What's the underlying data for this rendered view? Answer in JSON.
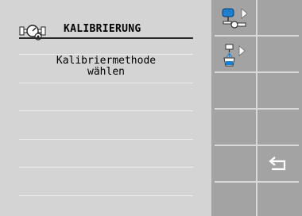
{
  "header": {
    "title": "KALIBRIERUNG",
    "icon": "calibration-gauge-icon"
  },
  "content": {
    "method_line1": "Kalibriermethode",
    "method_line2": "wählen"
  },
  "softkeys": [
    {
      "id": "sk1",
      "icon": "tank-pump-arrow-icon"
    },
    {
      "id": "sk2",
      "icon": "empty"
    },
    {
      "id": "sk3",
      "icon": "nozzle-bucket-arrow-icon"
    },
    {
      "id": "sk4",
      "icon": "empty"
    },
    {
      "id": "sk5",
      "icon": "empty"
    },
    {
      "id": "sk6",
      "icon": "empty"
    },
    {
      "id": "sk7",
      "icon": "empty"
    },
    {
      "id": "sk8",
      "icon": "empty"
    },
    {
      "id": "sk9",
      "icon": "empty"
    },
    {
      "id": "sk10",
      "icon": "back-arrow-icon"
    },
    {
      "id": "sk11",
      "icon": "empty"
    },
    {
      "id": "sk12",
      "icon": "empty"
    }
  ],
  "colors": {
    "background": "#d4d4d4",
    "softkey_panel": "#a3a3a3",
    "tank_blue": "#1e7fd0"
  }
}
